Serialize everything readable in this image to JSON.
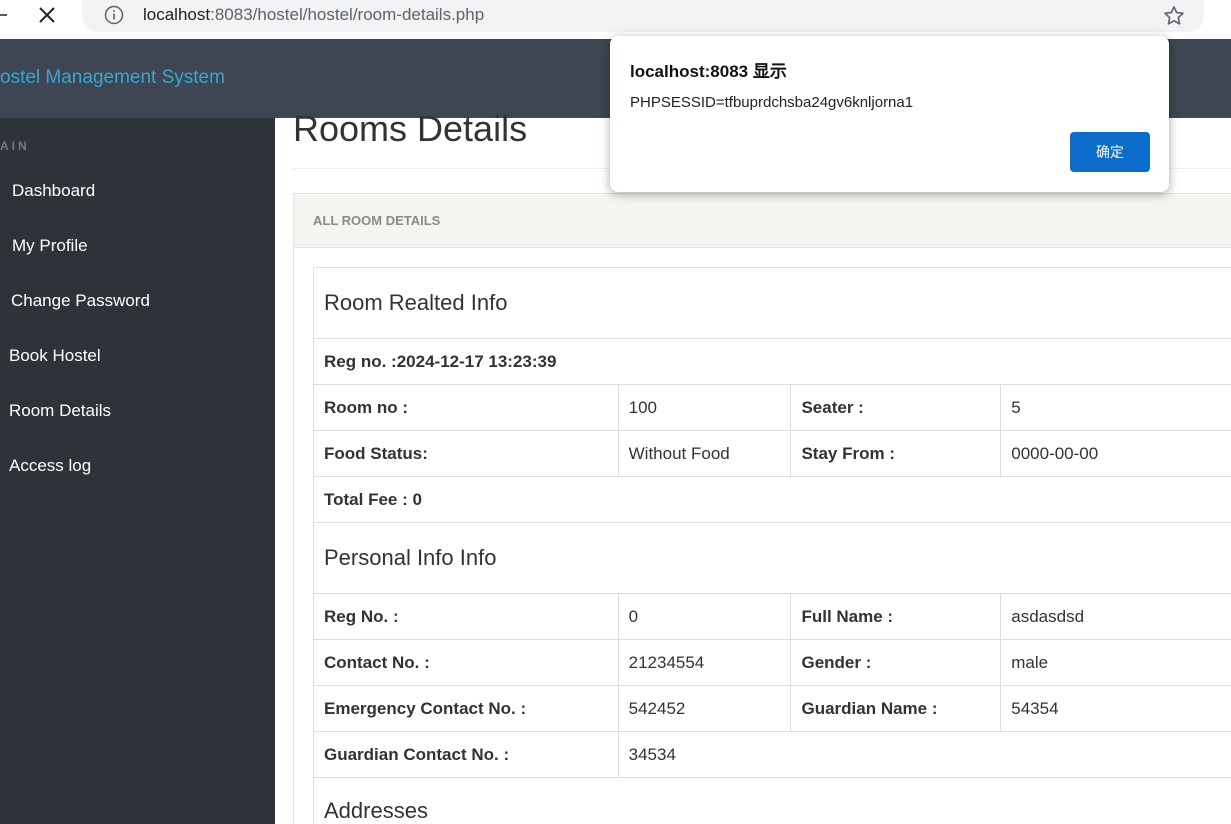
{
  "browser": {
    "url_host": "localhost",
    "url_rest": ":8083/hostel/hostel/room-details.php"
  },
  "header": {
    "brand": "ostel Management System"
  },
  "sidebar": {
    "heading": "AIN",
    "items": [
      {
        "label": "Dashboard"
      },
      {
        "label": "My Profile"
      },
      {
        "label": "Change Password"
      },
      {
        "label": "Book Hostel"
      },
      {
        "label": "Room Details"
      },
      {
        "label": "Access log"
      }
    ]
  },
  "main": {
    "title": "Rooms Details",
    "panel_heading": "ALL ROOM DETAILS",
    "room_section": "Room Realted Info",
    "reg_line": "Reg no. :2024-12-17 13:23:39",
    "room_no_label": "Room no :",
    "room_no": "100",
    "seater_label": "Seater :",
    "seater": "5",
    "food_label": "Food Status:",
    "food": "Without Food",
    "stay_label": "Stay From :",
    "stay": "0000-00-00",
    "total_fee": "Total Fee : 0",
    "personal_section": "Personal Info Info",
    "reg_no_label": "Reg No. :",
    "reg_no": "0",
    "full_name_label": "Full Name :",
    "full_name": "asdasdsd",
    "contact_label": "Contact No. :",
    "contact": "21234554",
    "gender_label": "Gender :",
    "gender": "male",
    "emergency_label": "Emergency Contact No. :",
    "emergency": "542452",
    "guardian_name_label": "Guardian Name :",
    "guardian_name": "54354",
    "guardian_contact_label": "Guardian Contact No. :",
    "guardian_contact": "34534",
    "addresses_section": "Addresses"
  },
  "dialog": {
    "title": "localhost:8083 显示",
    "message": "PHPSESSID=tfbuprdchsba24gv6knljorna1",
    "ok_label": "确定"
  }
}
